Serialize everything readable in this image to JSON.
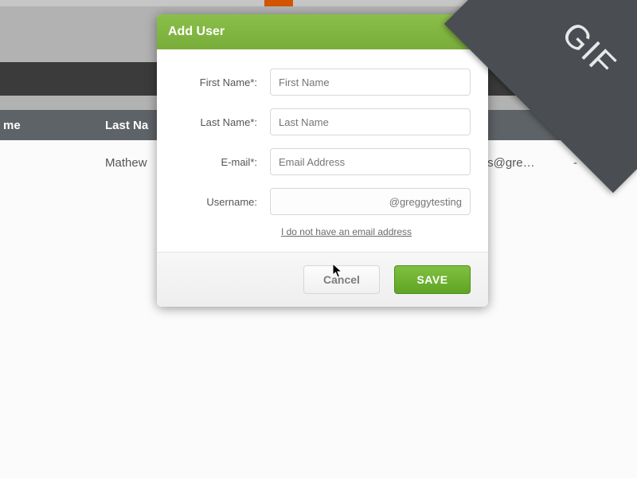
{
  "background": {
    "col_partial_left": "me",
    "col_last_name": "Last Na",
    "row_first_name": "Mathew",
    "row_email_partial": "/s@gre…",
    "row_dash": "-"
  },
  "modal": {
    "title": "Add User",
    "fields": {
      "first_name": {
        "label": "First Name*:",
        "placeholder": "First Name"
      },
      "last_name": {
        "label": "Last Name*:",
        "placeholder": "Last Name"
      },
      "email": {
        "label": "E-mail*:",
        "placeholder": "Email Address"
      },
      "username": {
        "label": "Username:",
        "placeholder": "@greggytesting"
      }
    },
    "no_email_link": "I do not have an email address",
    "buttons": {
      "cancel": "Cancel",
      "save": "SAVE"
    }
  },
  "ribbon": "GIF"
}
